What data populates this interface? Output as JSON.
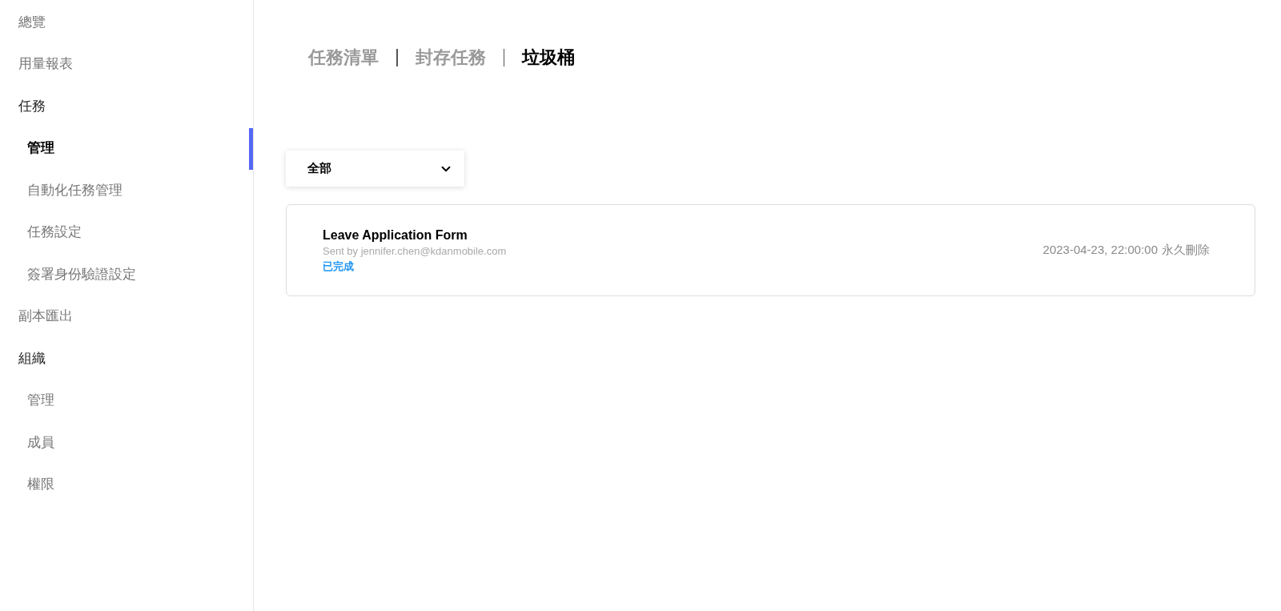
{
  "sidebar": {
    "items": [
      {
        "label": "總覽",
        "selected": false
      },
      {
        "label": "用量報表",
        "selected": false
      },
      {
        "label": "任務",
        "selected": false,
        "children": [
          {
            "label": "管理",
            "selected": true
          },
          {
            "label": "自動化任務管理",
            "selected": false
          },
          {
            "label": "任務設定",
            "selected": false
          },
          {
            "label": "簽署身份驗證設定",
            "selected": false
          }
        ]
      },
      {
        "label": "副本匯出",
        "selected": false
      },
      {
        "label": "組織",
        "selected": false,
        "children": [
          {
            "label": "管理",
            "selected": false
          },
          {
            "label": "成員",
            "selected": false
          },
          {
            "label": "權限",
            "selected": false
          }
        ]
      }
    ]
  },
  "tabs": [
    {
      "label": "任務清單",
      "selected": false
    },
    {
      "label": "封存任務",
      "selected": false
    },
    {
      "label": "垃圾桶",
      "selected": true
    }
  ],
  "filter": {
    "value": "全部"
  },
  "tasks": [
    {
      "title": "Leave Application Form",
      "sender": "Sent by jennifer.chen@kdanmobile.com",
      "status": "已完成",
      "date": "2023-04-23, 22:00:00",
      "action": "永久刪除"
    }
  ]
}
